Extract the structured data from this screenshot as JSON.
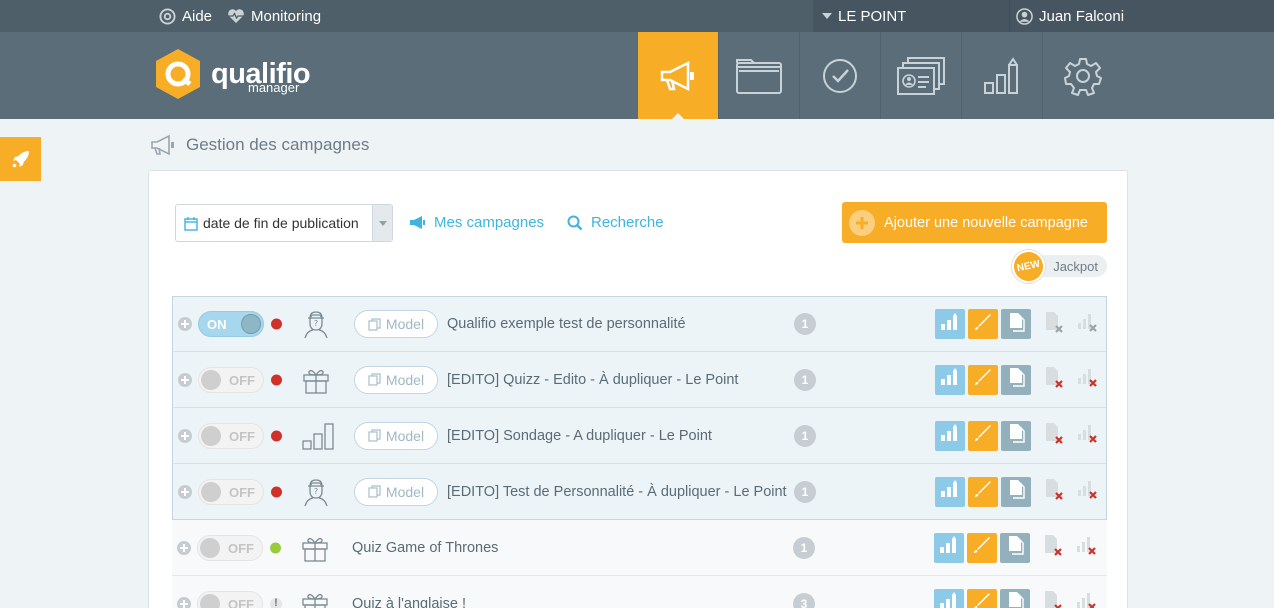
{
  "topbar": {
    "help_label": "Aide",
    "monitoring_label": "Monitoring",
    "account_name": "LE POINT",
    "user_name": "Juan Falconi"
  },
  "header": {
    "logo_name": "qualifio",
    "logo_sub": "manager",
    "tabs": [
      {
        "icon": "megaphone-icon",
        "active": true
      },
      {
        "icon": "folder-icon",
        "active": false
      },
      {
        "icon": "check-circle-icon",
        "active": false
      },
      {
        "icon": "contacts-card-icon",
        "active": false
      },
      {
        "icon": "bar-chart-icon",
        "active": false
      },
      {
        "icon": "gear-icon",
        "active": false
      }
    ]
  },
  "page": {
    "title": "Gestion des campagnes"
  },
  "toolbar": {
    "sort_value": "date de fin de publication",
    "my_campaigns_label": "Mes campagnes",
    "search_label": "Recherche",
    "add_label": "Ajouter une nouvelle campagne",
    "new_badge": "NEW",
    "jackpot_label": "Jackpot"
  },
  "colors": {
    "accent": "#f8ad26",
    "header": "#5a6d78",
    "topbar": "#4e5f69",
    "link": "#3fb4dd"
  },
  "campaigns": [
    {
      "on": true,
      "toggle_label": "ON",
      "status": "red",
      "type_icon": "personality-icon",
      "model": true,
      "model_label": "Model",
      "title": "Qualifio exemple test de personnalité",
      "count": "1"
    },
    {
      "on": false,
      "toggle_label": "OFF",
      "status": "red",
      "type_icon": "gift-icon",
      "model": true,
      "model_label": "Model",
      "title": "[EDITO] Quizz - Edito - À dupliquer - Le Point",
      "count": "1"
    },
    {
      "on": false,
      "toggle_label": "OFF",
      "status": "red",
      "type_icon": "poll-icon",
      "model": true,
      "model_label": "Model",
      "title": "[EDITO] Sondage - A dupliquer - Le Point",
      "count": "1"
    },
    {
      "on": false,
      "toggle_label": "OFF",
      "status": "red",
      "type_icon": "personality-icon",
      "model": true,
      "model_label": "Model",
      "title": "[EDITO] Test de Personnalité - À dupliquer - Le Point",
      "count": "1"
    },
    {
      "on": false,
      "toggle_label": "OFF",
      "status": "green",
      "type_icon": "gift-icon",
      "model": false,
      "title": "Quiz Game of Thrones",
      "count": "1"
    },
    {
      "on": false,
      "toggle_label": "OFF",
      "status": "warn",
      "status_text": "!",
      "type_icon": "gift-icon",
      "model": false,
      "title": "Quiz à l'anglaise !",
      "count": "3"
    }
  ]
}
